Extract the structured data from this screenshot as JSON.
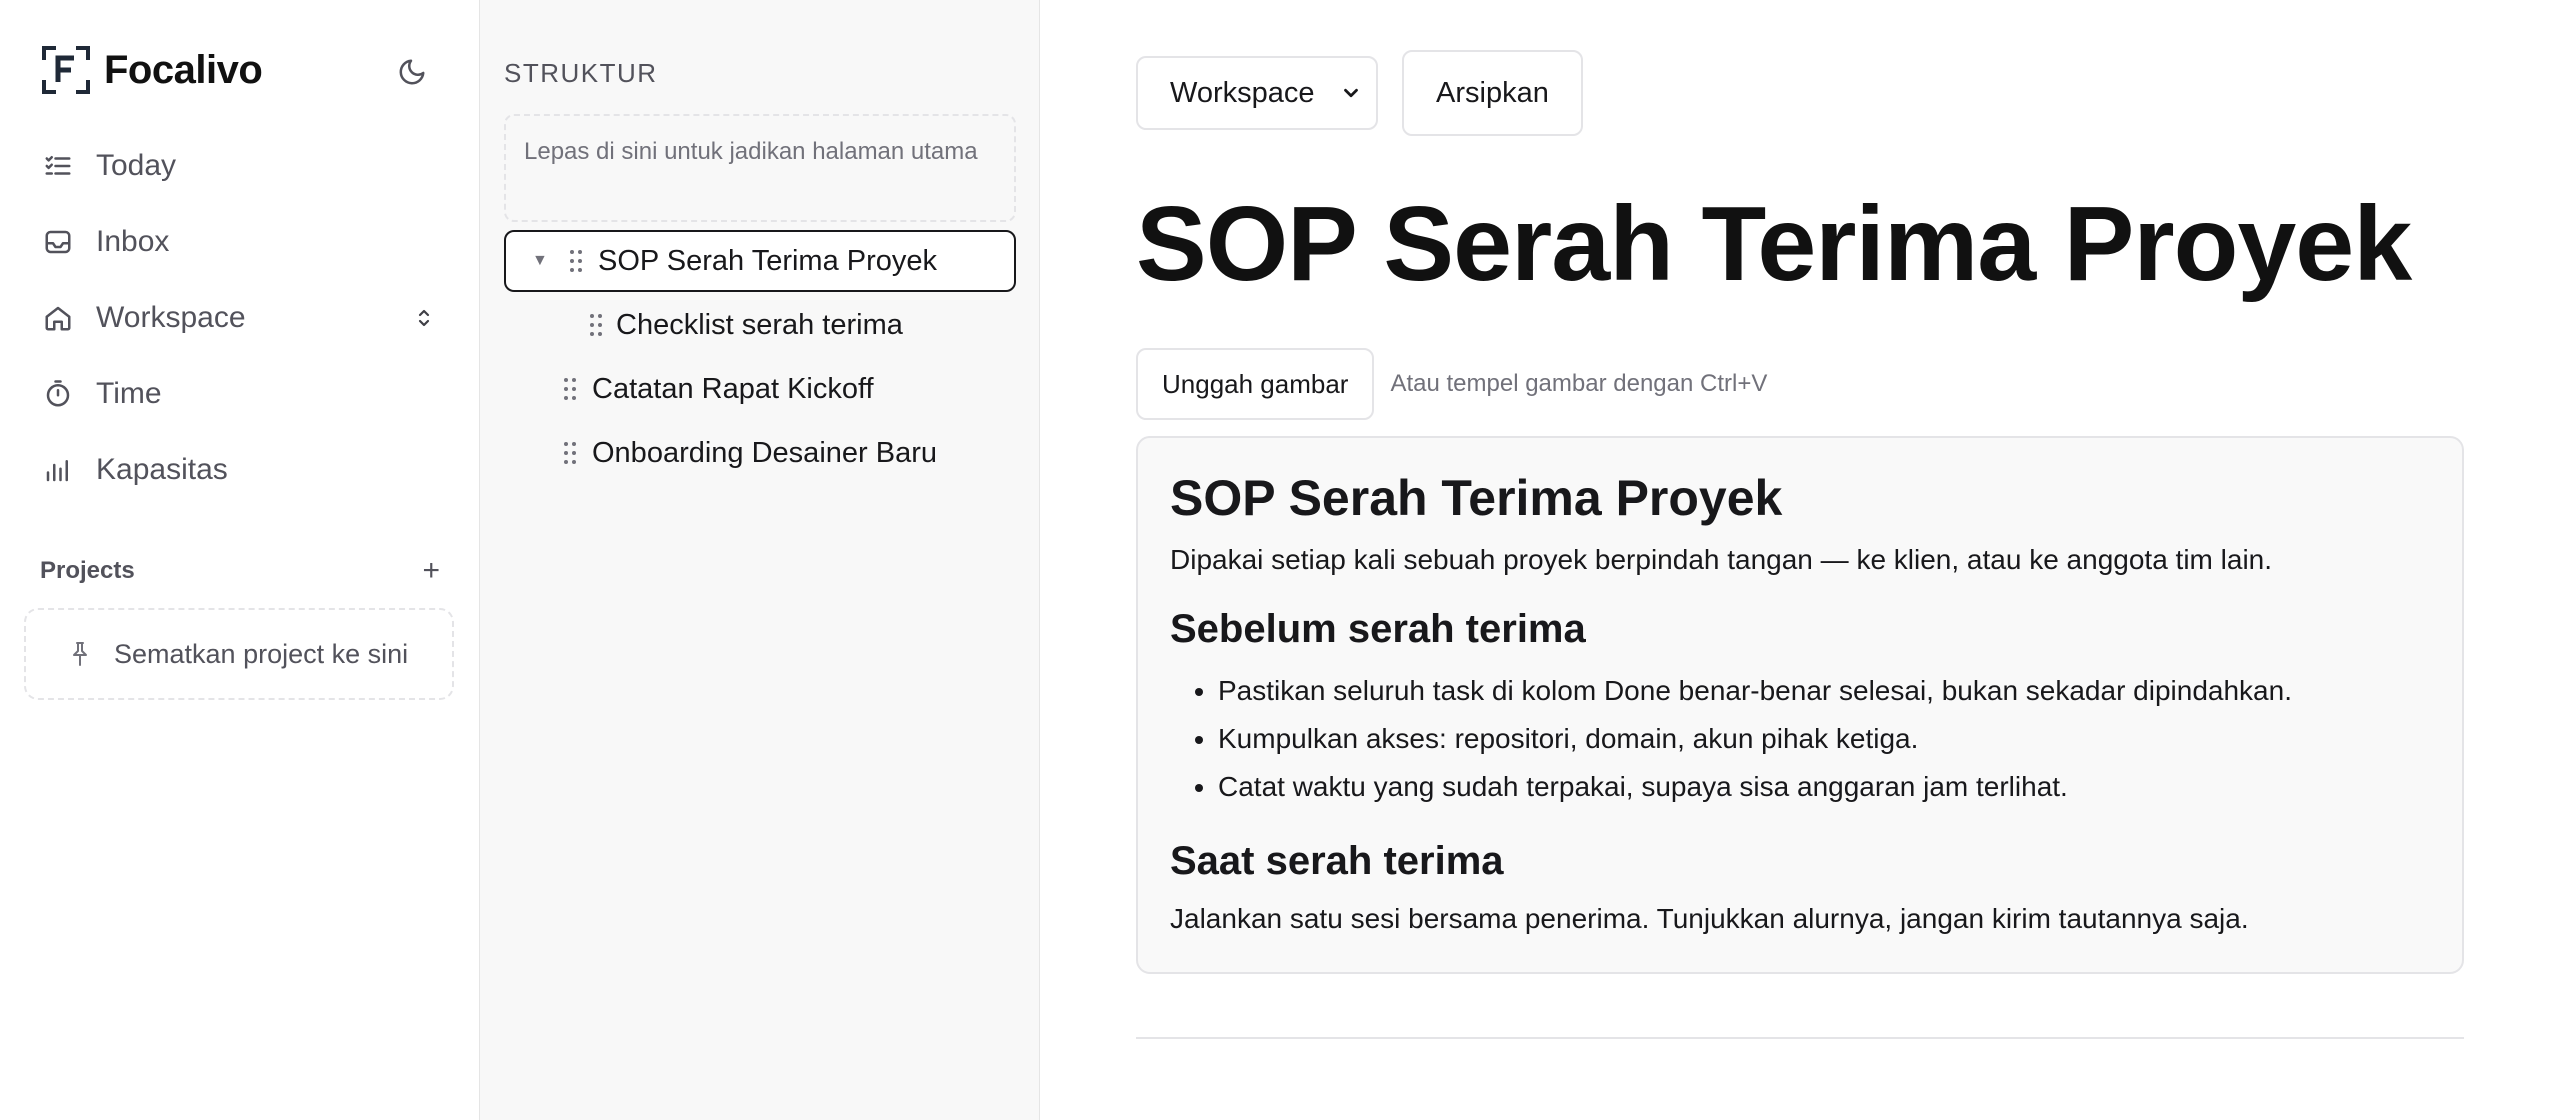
{
  "app": {
    "name": "Focalivo"
  },
  "sidebar": {
    "nav": [
      {
        "label": "Today",
        "icon": "checklist-icon"
      },
      {
        "label": "Inbox",
        "icon": "inbox-icon"
      },
      {
        "label": "Workspace",
        "icon": "home-icon",
        "expandable": true
      },
      {
        "label": "Time",
        "icon": "timer-icon"
      },
      {
        "label": "Kapasitas",
        "icon": "bar-chart-icon"
      }
    ],
    "projects": {
      "title": "Projects",
      "add_label": "+",
      "pin_placeholder": "Sematkan project ke sini"
    }
  },
  "structure": {
    "title": "STRUKTUR",
    "root_drop_hint": "Lepas di sini untuk jadikan halaman utama",
    "items": [
      {
        "label": "SOP Serah Terima Proyek",
        "level": 0,
        "expanded": true,
        "active": true
      },
      {
        "label": "Checklist serah terima",
        "level": 1
      },
      {
        "label": "Catatan Rapat Kickoff",
        "level": 0
      },
      {
        "label": "Onboarding Desainer Baru",
        "level": 0
      }
    ]
  },
  "main": {
    "workspace_select": {
      "selected": "Workspace"
    },
    "archive_label": "Arsipkan",
    "title": "SOP Serah Terima Proyek",
    "upload_label": "Unggah gambar",
    "upload_hint": "Atau tempel gambar dengan Ctrl+V",
    "doc": {
      "h1": "SOP Serah Terima Proyek",
      "intro": "Dipakai setiap kali sebuah proyek berpindah tangan — ke klien, atau ke anggota tim lain.",
      "section1_title": "Sebelum serah terima",
      "section1_items": [
        "Pastikan seluruh task di kolom Done benar-benar selesai, bukan sekadar dipindahkan.",
        "Kumpulkan akses: repositori, domain, akun pihak ketiga.",
        "Catat waktu yang sudah terpakai, supaya sisa anggaran jam terlihat."
      ],
      "section2_title": "Saat serah terima",
      "section2_text": "Jalankan satu sesi bersama penerima. Tunjukkan alurnya, jangan kirim tautannya saja."
    }
  },
  "colors": {
    "text": "#18181b",
    "muted": "#52525b",
    "border": "#e4e4e7",
    "panel_bg": "#f8f8f8"
  }
}
